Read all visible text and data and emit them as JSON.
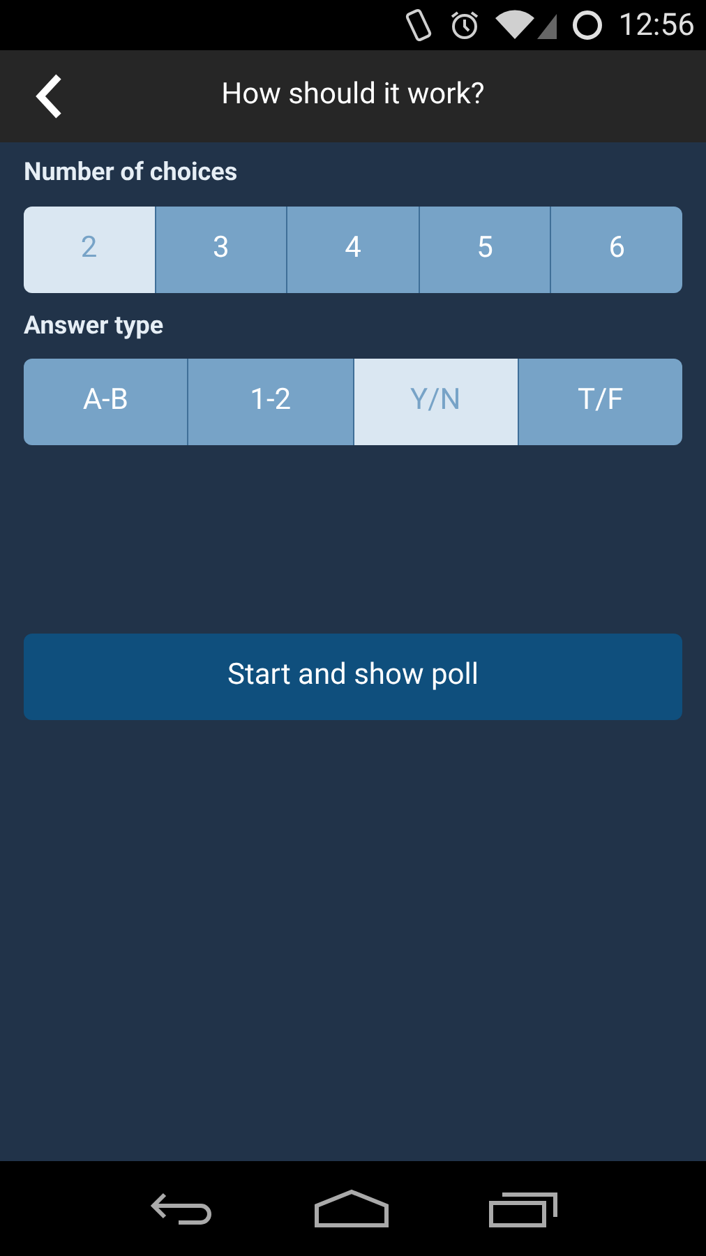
{
  "status_bar": {
    "time": "12:56"
  },
  "header": {
    "title": "How should it work?"
  },
  "choices": {
    "label": "Number of choices",
    "options": [
      {
        "label": "2",
        "selected": true
      },
      {
        "label": "3",
        "selected": false
      },
      {
        "label": "4",
        "selected": false
      },
      {
        "label": "5",
        "selected": false
      },
      {
        "label": "6",
        "selected": false
      }
    ]
  },
  "answer_type": {
    "label": "Answer type",
    "options": [
      {
        "label": "A-B",
        "selected": false
      },
      {
        "label": "1-2",
        "selected": false
      },
      {
        "label": "Y/N",
        "selected": true
      },
      {
        "label": "T/F",
        "selected": false
      }
    ]
  },
  "start_button": "Start and show poll"
}
